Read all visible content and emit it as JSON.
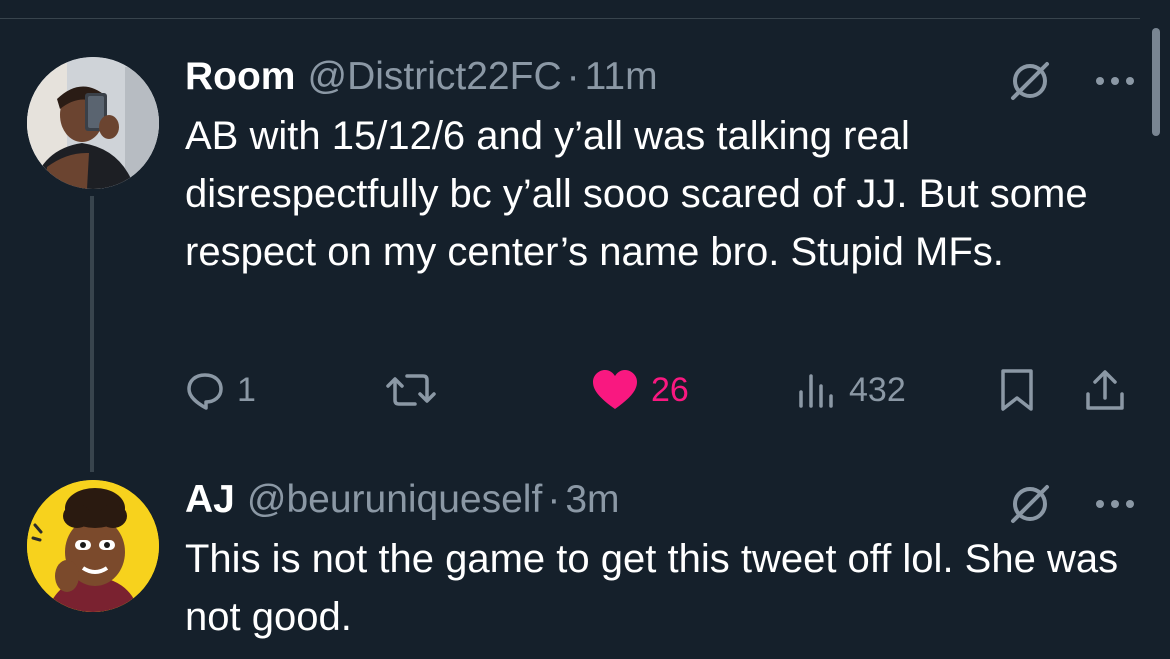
{
  "tweets": [
    {
      "name": "Room",
      "handle": "@District22FC",
      "separator": "·",
      "time": "11m",
      "text": "AB with 15/12/6 and y’all was talking real disrespectfully bc y’all sooo scared of JJ. But some respect on my center’s name bro. Stupid MFs.",
      "avatar_icon": "user-photo-avatar",
      "actions": {
        "reply_count": "1",
        "retweet_count": "",
        "like_count": "26",
        "view_count": "432"
      },
      "liked": true
    },
    {
      "name": "AJ",
      "handle": "@beuruniqueself",
      "separator": "·",
      "time": "3m",
      "text": "This is not the game to get this tweet off lol. She was not good.",
      "avatar_icon": "bitmoji-avatar"
    }
  ],
  "colors": {
    "background": "#15202b",
    "secondary_text": "#8b98a5",
    "like": "#f91880",
    "divider": "#38444d"
  },
  "icons": [
    "grok-icon",
    "more-icon",
    "reply-icon",
    "retweet-icon",
    "heart-icon",
    "views-icon",
    "bookmark-icon",
    "share-icon"
  ]
}
